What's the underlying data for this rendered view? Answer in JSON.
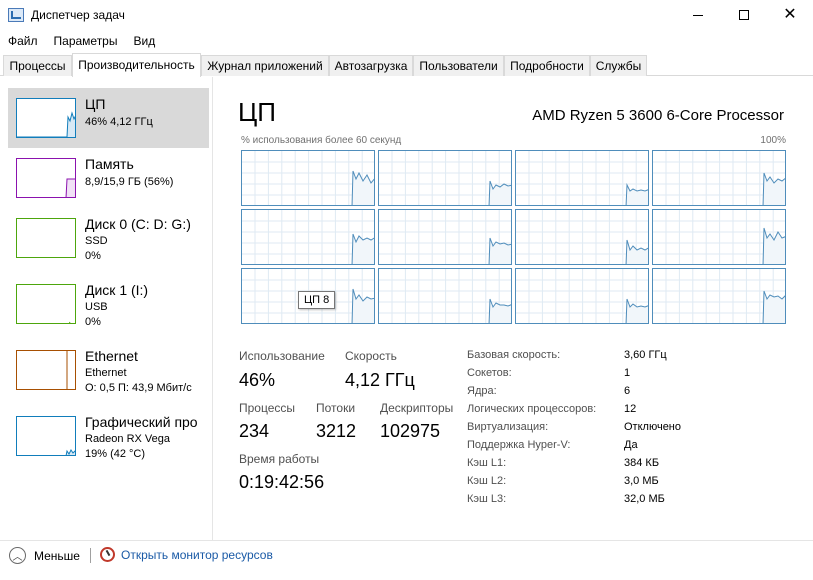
{
  "window": {
    "title": "Диспетчер задач",
    "close_glyph": "✕"
  },
  "menu": [
    "Файл",
    "Параметры",
    "Вид"
  ],
  "tabs": [
    "Процессы",
    "Производительность",
    "Журнал приложений",
    "Автозагрузка",
    "Пользователи",
    "Подробности",
    "Службы"
  ],
  "active_tab": 1,
  "resources": [
    {
      "name": "ЦП",
      "lines": [
        "46% 4,12 ГГц"
      ],
      "color": "#117dbb",
      "selected": true
    },
    {
      "name": "Память",
      "lines": [
        "8,9/15,9 ГБ (56%)"
      ],
      "color": "#8b12ae"
    },
    {
      "name": "Диск 0 (C: D: G:)",
      "lines": [
        "SSD",
        "0%"
      ],
      "color": "#4da60c"
    },
    {
      "name": "Диск 1 (I:)",
      "lines": [
        "USB",
        "0%"
      ],
      "color": "#4da60c"
    },
    {
      "name": "Ethernet",
      "lines": [
        "Ethernet",
        "О: 0,5 П: 43,9 Мбит/с"
      ],
      "color": "#a74f01"
    },
    {
      "name": "Графический про",
      "lines": [
        "Radeon RX Vega",
        "19% (42 °C)"
      ],
      "color": "#117dbb"
    }
  ],
  "cpu": {
    "title": "ЦП",
    "model": "AMD Ryzen 5 3600 6-Core Processor",
    "graph_label": "% использования более 60 секунд",
    "graph_max": "100%",
    "tooltip": "ЦП 8",
    "core_color": "#4f8dbb",
    "stats": {
      "usage_label": "Использование",
      "usage_value": "46%",
      "speed_label": "Скорость",
      "speed_value": "4,12 ГГц",
      "processes_label": "Процессы",
      "processes_value": "234",
      "threads_label": "Потоки",
      "threads_value": "3212",
      "handles_label": "Дескрипторы",
      "handles_value": "102975",
      "uptime_label": "Время работы",
      "uptime_value": "0:19:42:56"
    },
    "specs": [
      {
        "label": "Базовая скорость:",
        "value": "3,60 ГГц"
      },
      {
        "label": "Сокетов:",
        "value": "1"
      },
      {
        "label": "Ядра:",
        "value": "6"
      },
      {
        "label": "Логических процессоров:",
        "value": "12"
      },
      {
        "label": "Виртуализация:",
        "value": "Отключено"
      },
      {
        "label": "Поддержка Hyper-V:",
        "value": "Да"
      },
      {
        "label": "Кэш L1:",
        "value": "384 КБ"
      },
      {
        "label": "Кэш L2:",
        "value": "3,0 МБ"
      },
      {
        "label": "Кэш L3:",
        "value": "32,0 МБ"
      }
    ]
  },
  "footer": {
    "less_label": "Меньше",
    "monitor_label": "Открыть монитор ресурсов"
  }
}
